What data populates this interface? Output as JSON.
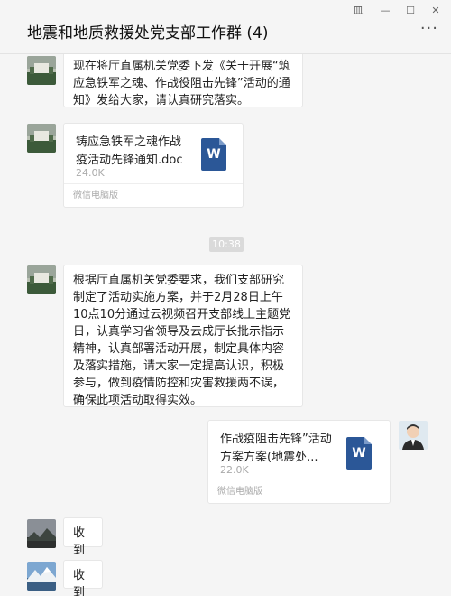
{
  "window": {
    "title": "地震和地质救援处党支部工作群 (4)",
    "buttons": {
      "pin": "⽫",
      "minimize": "—",
      "maximize": "☐",
      "close": "✕"
    },
    "more": "···"
  },
  "messages": {
    "m1": {
      "text": "现在将厅直属机关党委下发《关于开展“筑应急铁军之魂、作战役阻击先锋”活动的通知》发给大家，请认真研究落实。"
    },
    "m2": {
      "file_name": "铸应急铁军之魂作战疫活动先锋通知.doc",
      "file_size": "24.0K",
      "source": "微信电脑版",
      "icon": "W"
    },
    "time": "10:38",
    "m3": {
      "text": "根据厅直属机关党委要求，我们支部研究制定了活动实施方案，并于2月28日上午10点10分通过云视频召开支部线上主题党日，认真学习省领导及云成厅长批示指示精神，认真部署活动开展，制定具体内容及落实措施，请大家一定提高认识，积极参与，做到疫情防控和灾害救援两不误，确保此项活动取得实效。"
    },
    "m4": {
      "file_name": "作战疫阻击先锋”活动方案方案(地震处...",
      "file_size": "22.0K",
      "source": "微信电脑版",
      "icon": "W"
    },
    "m5": {
      "text": "收到"
    },
    "m6": {
      "text": "收到"
    }
  },
  "colors": {
    "bg": "#f5f5f5",
    "bubble": "#ffffff",
    "word_blue": "#2b5797",
    "timestamp_bg": "#dadada"
  }
}
